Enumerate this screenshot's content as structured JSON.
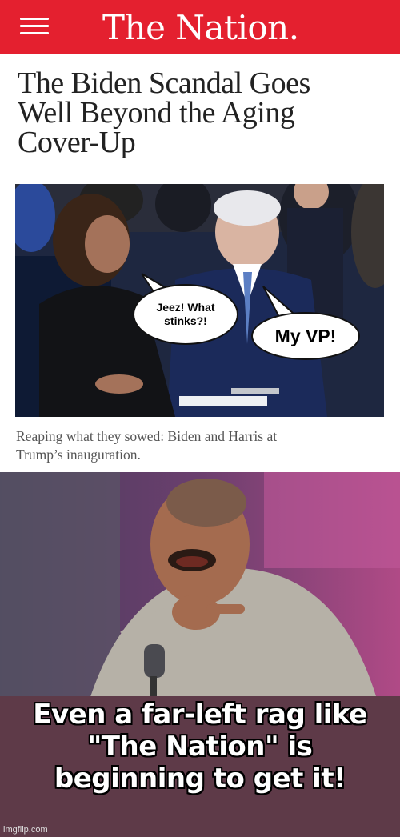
{
  "header": {
    "logo": "The Nation.",
    "brand_color": "#e4202f"
  },
  "article": {
    "headline_lines": [
      "The Biden Scandal Goes",
      "Well Beyond the Aging",
      "Cover-Up"
    ],
    "caption_lines": [
      "Reaping what they sowed: Biden and Harris at",
      "Trump’s inauguration."
    ]
  },
  "photo": {
    "bubble_left_lines": [
      "Jeez!  What",
      "stinks?!"
    ],
    "bubble_right": "My VP!"
  },
  "meme": {
    "text_lines": [
      "Even a far-left rag like",
      "\"The Nation\" is",
      "beginning to get it!"
    ],
    "watermark": "imgflip.com"
  }
}
